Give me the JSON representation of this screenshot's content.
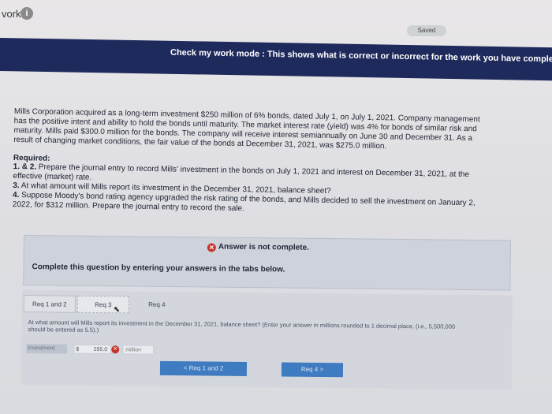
{
  "header": {
    "work_label": "vork",
    "info_icon": "info-icon",
    "saved_label": "Saved"
  },
  "mode_bar": {
    "text": "Check my work mode : This shows what is correct or incorrect for the work you have completed"
  },
  "problem": {
    "lines": [
      "Mills Corporation acquired as a long-term investment $250 million of 6% bonds, dated July 1, on July 1, 2021. Company management",
      "has the positive intent and ability to hold the bonds until maturity. The market interest rate (yield) was 4% for bonds of similar risk and",
      "maturity. Mills paid $300.0 million for the bonds. The company will receive interest semiannually on June 30 and December 31. As a",
      "result of changing market conditions, the fair value of the bonds at December 31, 2021, was $275.0 million."
    ]
  },
  "required": {
    "heading": "Required:",
    "items": [
      {
        "num": "1. & 2.",
        "text": " Prepare the journal entry to record Mills' investment in the bonds on July 1, 2021 and interest on December 31, 2021, at the"
      },
      {
        "num": "",
        "text": "effective (market) rate."
      },
      {
        "num": "3.",
        "text": " At what amount will Mills report its investment in the December 31, 2021, balance sheet?"
      },
      {
        "num": "4.",
        "text": " Suppose Moody's bond rating agency upgraded the risk rating of the bonds, and Mills decided to sell the investment on January 2,"
      },
      {
        "num": "",
        "text": "2022, for $312 million. Prepare the journal entry to record the sale."
      }
    ]
  },
  "answer_panel": {
    "status": "Answer is not complete.",
    "instruction": "Complete this question by entering your answers in the tabs below."
  },
  "tabs": [
    {
      "label": "Req 1 and 2"
    },
    {
      "label": "Req 3"
    },
    {
      "label": "Req 4"
    }
  ],
  "question": {
    "text": "At what amount will Mills report its investment in the December 31, 2021, balance sheet? (Enter your answer in millions rounded to 1 decimal place, (i.e., 5,500,000 should be entered as 5.5).)"
  },
  "field": {
    "label": "Investment",
    "currency": "$",
    "value": "295.0",
    "unit": "million",
    "status": "incorrect"
  },
  "nav": {
    "prev_label": "< Req 1 and 2",
    "next_label": "Req 4 >"
  },
  "colors": {
    "mode_bar": "#1f2a5c",
    "nav_button": "#3f7bc0",
    "incorrect": "#c8342c"
  }
}
